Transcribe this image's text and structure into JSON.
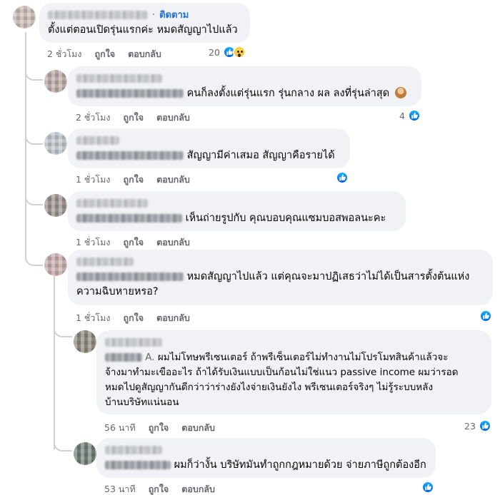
{
  "comments": [
    {
      "text": "ตั้งแต่ตอนเปิดรุ่นแรกค่ะ หมดสัญญาไปแล้ว",
      "follow": "ติดตาม",
      "time": "2 ชั่วโมง",
      "like": "ถูกใจ",
      "reply": "ตอบกลับ",
      "reactions": "20",
      "avatar_color": "#c9b8b0"
    },
    {
      "text": "คนก็ลงตั้งแต่รุ่นแรก รุ่นกลาง ผล ลงที่รุ่นล่าสุด",
      "time": "2 ชั่วโมง",
      "like": "ถูกใจ",
      "reply": "ตอบกลับ",
      "reactions": "4",
      "avatar_color": "#b7a7a3",
      "emoji": "woman-shrugging-emoji"
    },
    {
      "text": "สัญญามีค่าเสมอ สัญญาคือรายได้",
      "time": "1 ชั่วโมง",
      "like": "ถูกใจ",
      "reply": "ตอบกลับ",
      "reactions": "",
      "avatar_color": "#bfc3c9"
    },
    {
      "text": "เห็นถ่ายรูปกับ คุณบอบคุณแซมบอสพอลนะคะ",
      "time": "1 ชั่วโมง",
      "like": "ถูกใจ",
      "reply": "ตอบกลับ",
      "reactions": "",
      "avatar_color": "#9a8f8c"
    },
    {
      "text_line1": "หมดสัญญาไปแล้ว แต่คุณจะมาปฏิเสธว่าไม่ได้เป็นสารตั้งต้นแห่ง",
      "text_line2": "ความฉิบหายหรอ?",
      "time": "1 ชั่วโมง",
      "like": "ถูกใจ",
      "reply": "ตอบกลับ",
      "reactions": "",
      "avatar_color": "#c4aaa8"
    },
    {
      "prefix": "A.",
      "text_line1": "ผมไม่โทษพรีเซนเตอร์ ถ้าพรีเซ็นเตอร์ไม่ทำงานไม่โปรโมทสินค้าแล้วจะ",
      "text_line2": "จ้างมาทำมะเขืออะไร ถ้าได้รับเงินแบบเป็นก้อนไม่ใช่แนว passive income ผมว่ารอด",
      "text_line3": "หมดไปดูสัญญากันดีกว่าว่าร่างยังไงจ่ายเงินยังไง พรีเซนเตอร์จริงๆ ไม่รู้ระบบหลัง",
      "text_line4": "บ้านบริษัทแน่นอน",
      "time": "56 นาที",
      "like": "ถูกใจ",
      "reply": "ตอบกลับ",
      "reactions": "23",
      "avatar_color": "#8a857a"
    },
    {
      "text": "ผมก็ว่างั้น บริษัทมันทำถูกกฎหมายด้วย จ่ายภาษีถูกต้องอีก",
      "time": "53 นาที",
      "like": "ถูกใจ",
      "reply": "ตอบกลับ",
      "reactions": "",
      "avatar_color": "#6c7a72"
    }
  ],
  "colors": {
    "bubble": "#f0f2f5",
    "meta": "#65676b",
    "link": "#216fdb",
    "like": "#1877f2"
  },
  "icons": [
    "like-reaction-icon",
    "wow-reaction-icon",
    "woman-shrugging-emoji"
  ]
}
